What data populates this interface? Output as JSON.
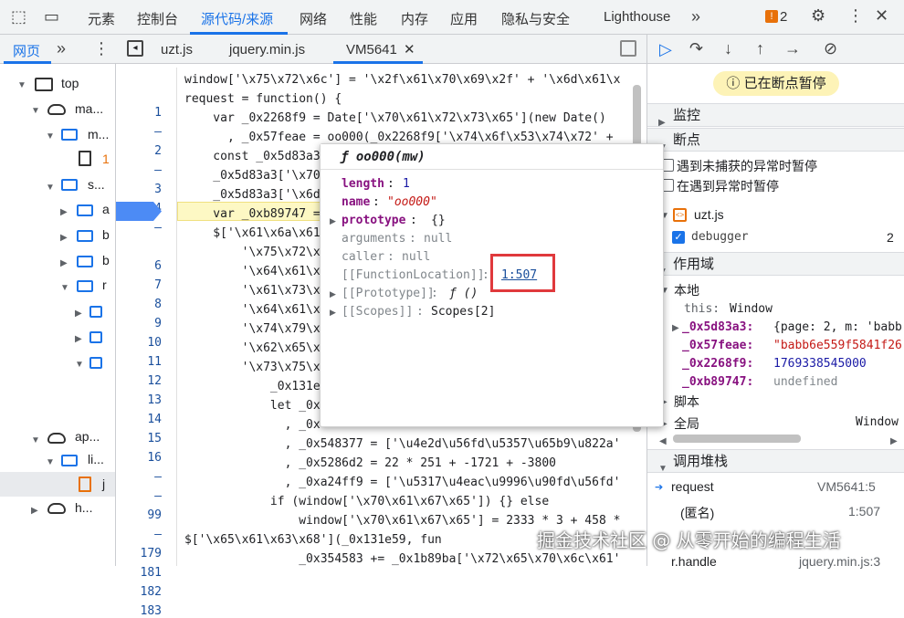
{
  "toolbar": {
    "tabs": [
      "元素",
      "控制台",
      "源代码/来源",
      "网络",
      "性能",
      "内存",
      "应用",
      "隐私与安全",
      "Lighthouse"
    ],
    "issues_count": "2"
  },
  "navigator": {
    "tabs": [
      "网页"
    ],
    "items": [
      "top",
      "ma...",
      "m...",
      "s...",
      "a",
      "b",
      "b",
      "r",
      "ap...",
      "li...",
      "j",
      "h..."
    ],
    "badge": "1"
  },
  "editor": {
    "tabs": [
      "uzt.js",
      "jquery.min.js",
      "VM5641"
    ],
    "line_numbers": [
      "1",
      "–",
      "2",
      "–",
      "3",
      "4",
      "–",
      "5",
      "6",
      "7",
      "8",
      "9",
      "10",
      "11",
      "12",
      "13",
      "14",
      "15",
      "16",
      "–",
      "–",
      "99",
      "–",
      "179",
      "181",
      "182",
      "183"
    ],
    "lines": [
      "window['\\x75\\x72\\x6c'] = '\\x2f\\x61\\x70\\x69\\x2f' + '\\x6d\\x61\\x",
      "request = function() {",
      "    var _0x2268f9 = Date['\\x70\\x61\\x72\\x73\\x65'](new Date()",
      "      , _0x57feae = oo000(_0x2268f9['\\x74\\x6f\\x53\\x74\\x72' +",
      "    const _0x5d83a3",
      "    _0x5d83a3['\\x70",
      "    _0x5d83a3['\\x6d",
      "    var _0xb89747 =",
      "    $['\\x61\\x6a\\x61",
      "        '\\x75\\x72\\x",
      "        '\\x64\\x61\\x",
      "        '\\x61\\x73\\x",
      "        '\\x64\\x61\\x",
      "        '\\x74\\x79\\x",
      "        '\\x62\\x65\\x",
      "        '\\x73\\x75\\x",
      "            _0x131e",
      "            let _0x",
      "              , _0x",
      "              , _0x548377 = ['\\u4e2d\\u56fd\\u5357\\u65b9\\u822a'",
      "              , _0x5286d2 = 22 * 251 + -1721 + -3800",
      "              , _0xa24ff9 = ['\\u5317\\u4eac\\u9996\\u90fd\\u56fd'",
      "            if (window['\\x70\\x61\\x67\\x65']) {} else",
      "                window['\\x70\\x61\\x67\\x65'] = 2333 * 3 + 458 *",
      "$['\\x65\\x61\\x63\\x68'](_0x131e59, fun",
      "                _0x354583 += _0x1b89ba['\\x72\\x65\\x70\\x6c\\x61'"
    ]
  },
  "popup": {
    "title": "ƒ oo000(mw)",
    "length_key": "length",
    "length_val": "1",
    "name_key": "name",
    "name_val": "\"oo000\"",
    "prototype_key": "prototype",
    "prototype_val": "{}",
    "arguments_key": "arguments",
    "arguments_val": "null",
    "caller_key": "caller",
    "caller_val": "null",
    "fl_key": "[[FunctionLocation]]",
    "fl_val": "1:507",
    "proto_key": "[[Prototype]]",
    "proto_val": "ƒ ()",
    "scopes_key": "[[Scopes]]",
    "scopes_val": "Scopes[2]"
  },
  "debugger": {
    "paused": "已在断点暂停",
    "sections": {
      "watch": "监控",
      "breakpoints": "断点",
      "scope": "作用域",
      "callstack": "调用堆栈"
    },
    "pause_uncaught": "遇到未捕获的异常时暂停",
    "pause_caught": "在遇到异常时暂停",
    "bp_file": "uzt.js",
    "bp_text": "debugger",
    "bp_line": "2",
    "scope_local": "本地",
    "this_key": "this:",
    "this_val": "Window",
    "vars": [
      {
        "k": "_0x5d83a3:",
        "v": "{page: 2, m: 'babb"
      },
      {
        "k": "_0x57feae:",
        "v": "\"babb6e559f5841f26"
      },
      {
        "k": "_0x2268f9:",
        "v": "1769338545000"
      },
      {
        "k": "_0xb89747:",
        "v": "undefined"
      }
    ],
    "script": "脚本",
    "global": "全局",
    "global_val": "Window",
    "stack": [
      {
        "fn": "request",
        "loc": "VM5641:5"
      },
      {
        "fn": "(匿名)",
        "loc": "1:507"
      },
      {
        "fn": "r.handle",
        "loc": "jquery.min.js:3"
      }
    ]
  },
  "watermark": "掘金技术社区 @ 从零开始的编程生活",
  "colors": {
    "accent": "#1a73e8",
    "highlight": "#e0393c",
    "paused_bg": "#fdf3b7"
  }
}
